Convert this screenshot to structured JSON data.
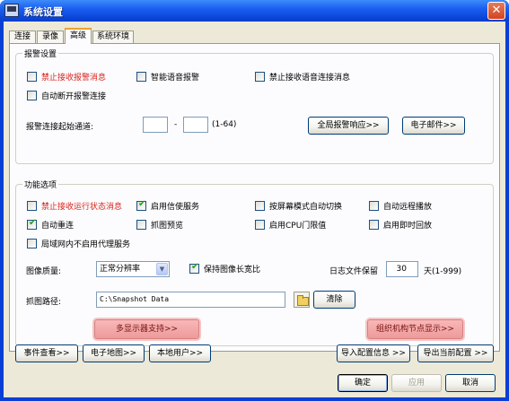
{
  "window": {
    "title": "系统设置"
  },
  "tabs": [
    {
      "label": "连接"
    },
    {
      "label": "录像"
    },
    {
      "label": "高级",
      "active": true
    },
    {
      "label": "系统环境"
    }
  ],
  "alarm": {
    "group_title": "报警设置",
    "checkboxes": [
      {
        "label": "禁止接收报警消息",
        "checked": false,
        "color": "#d8241c"
      },
      {
        "label": "智能语音报警",
        "checked": false
      },
      {
        "label": "禁止接收语音连接消息",
        "checked": false
      },
      {
        "label": "自动断开报警连接",
        "checked": false
      }
    ],
    "channel_label": "报警连接起始通道:",
    "channel_from": "",
    "channel_dash": "-",
    "channel_to": "",
    "channel_range": "(1-64)",
    "global_response_button": "全局报警响应>>",
    "email_button": "电子邮件>>"
  },
  "functions": {
    "group_title": "功能选项",
    "checkboxes": [
      {
        "label": "禁止接收运行状态消息",
        "checked": false,
        "color": "#d8241c"
      },
      {
        "label": "启用信使服务",
        "checked": true
      },
      {
        "label": "按屏幕模式自动切换",
        "checked": false
      },
      {
        "label": "自动远程播放",
        "checked": false
      },
      {
        "label": "自动重连",
        "checked": true
      },
      {
        "label": "抓图预览",
        "checked": false
      },
      {
        "label": "启用CPU门限值",
        "checked": false
      },
      {
        "label": "启用即时回放",
        "checked": false
      },
      {
        "label": "局域网内不启用代理服务",
        "checked": false
      }
    ],
    "image_quality_label": "图像质量:",
    "image_quality_value": "正常分辨率",
    "keep_aspect_label": "保持图像长宽比",
    "keep_aspect_checked": true,
    "log_keep_label": "日志文件保留",
    "log_keep_value": "30",
    "log_keep_unit": "天(1-999)",
    "snapshot_path_label": "抓图路径:",
    "snapshot_path_value": "C:\\Snapshot Data",
    "clear_button": "清除",
    "multi_display_button": "多显示器支持>>",
    "org_node_button": "组织机构节点显示>>"
  },
  "bottom_buttons": {
    "event_view": "事件查看>>",
    "emap": "电子地图>>",
    "local_user": "本地用户>>",
    "import_config": "导入配置信息 >>",
    "export_config": "导出当前配置 >>"
  },
  "dialog_buttons": {
    "ok": "确定",
    "apply": "应用",
    "cancel": "取消"
  }
}
